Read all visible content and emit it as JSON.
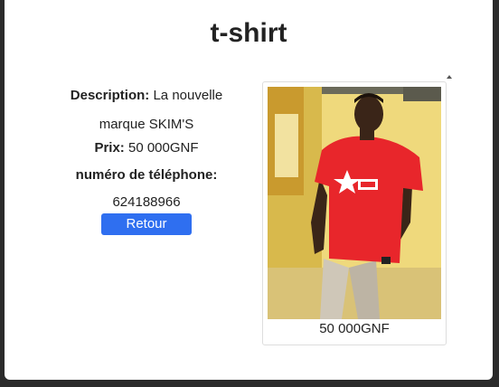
{
  "product": {
    "title": "t-shirt",
    "description_label": "Description:",
    "description_value": "La nouvelle marque SKIM'S",
    "price_label": "Prix:",
    "price_value": "50 000GNF",
    "phone_label": "numéro de téléphone:",
    "phone_value": "624188966",
    "back_button": "Retour",
    "image_caption": "50 000GNF"
  },
  "colors": {
    "button_bg": "#2f6ff0",
    "shirt_red": "#e8262b"
  }
}
